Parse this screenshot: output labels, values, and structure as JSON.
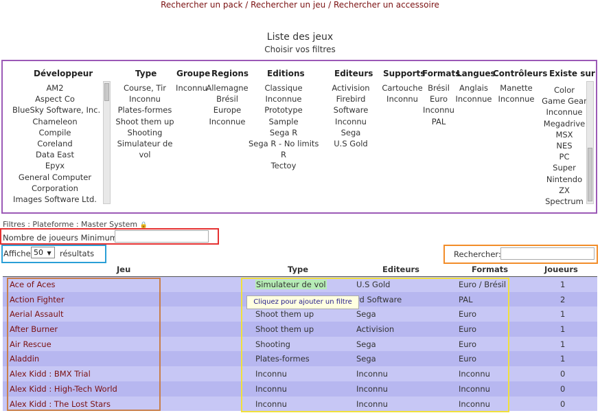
{
  "nav": {
    "link_pack": "Rechercher un pack",
    "sep1": "/",
    "link_jeu": "Rechercher un jeu",
    "sep2": "/",
    "link_accessoire": "Rechercher un accessoire"
  },
  "page": {
    "title": "Liste des jeux",
    "subtitle": "Choisir vos filtres"
  },
  "filters": {
    "developpeur": {
      "label": "Développeur",
      "items": [
        "AM2",
        "Aspect Co",
        "BlueSky Software, Inc.",
        "Chameleon",
        "Compile",
        "Coreland",
        "Data East",
        "Epyx",
        "General Computer",
        "Corporation",
        "Images Software Ltd."
      ]
    },
    "type": {
      "label": "Type",
      "items": [
        "Course, Tir",
        "Inconnu",
        "Plates-formes",
        "Shoot them up",
        "Shooting",
        "Simulateur de",
        "vol"
      ]
    },
    "groupe": {
      "label": "Groupe",
      "items": [
        "Inconnu"
      ]
    },
    "regions": {
      "label": "Regions",
      "items": [
        "Allemagne",
        "Brésil",
        "Europe",
        "Inconnue"
      ]
    },
    "editions": {
      "label": "Editions",
      "items": [
        "Classique",
        "Inconnue",
        "Prototype",
        "Sample",
        "Sega R",
        "Sega R - No limits",
        "R",
        "Tectoy"
      ]
    },
    "editeurs": {
      "label": "Editeurs",
      "items": [
        "Activision",
        "Firebird",
        "Software",
        "Inconnu",
        "Sega",
        "U.S Gold"
      ]
    },
    "supports": {
      "label": "Supports",
      "items": [
        "Cartouche",
        "Inconnu"
      ]
    },
    "formats": {
      "label": "Formats",
      "items": [
        "Brésil",
        "Euro",
        "Inconnu",
        "PAL"
      ]
    },
    "langues": {
      "label": "Langues",
      "items": [
        "Anglais",
        "Inconnue"
      ]
    },
    "controleurs": {
      "label": "Contrôleurs",
      "items": [
        "Manette",
        "Inconnue"
      ]
    },
    "existe_sur": {
      "label": "Existe sur",
      "items": [
        "Color",
        "Game Gear",
        "Inconnue",
        "Megadrive",
        "MSX",
        "NES",
        "PC",
        "Super",
        "Nintendo",
        "ZX",
        "Spectrum"
      ]
    }
  },
  "active_filters": {
    "text": "Filtres : Plateforme : Master System",
    "lock_icon": "🔒"
  },
  "min_players": {
    "label": "Nombre de joueurs Minimum :",
    "value": ""
  },
  "page_size": {
    "label": "Affiche",
    "value": "50",
    "arrow": "▼",
    "suffix": "résultats"
  },
  "search": {
    "label": "Rechercher:",
    "value": ""
  },
  "table": {
    "headers": {
      "jeu": "Jeu",
      "type": "Type",
      "editeurs": "Editeurs",
      "formats": "Formats",
      "joueurs": "Joueurs"
    },
    "rows": [
      {
        "jeu": "Ace of Aces",
        "type": "Simulateur de vol",
        "editeurs": "U.S Gold",
        "formats": "Euro / Brésil",
        "joueurs": "1"
      },
      {
        "jeu": "Action Fighter",
        "type": "",
        "editeurs": "rd Software",
        "formats": "PAL",
        "joueurs": "2"
      },
      {
        "jeu": "Aerial Assault",
        "type": "Shoot them up",
        "editeurs": "Sega",
        "formats": "Euro",
        "joueurs": "1"
      },
      {
        "jeu": "After Burner",
        "type": "Shoot them up",
        "editeurs": "Activision",
        "formats": "Euro",
        "joueurs": "1"
      },
      {
        "jeu": "Air Rescue",
        "type": "Shooting",
        "editeurs": "Sega",
        "formats": "Euro",
        "joueurs": "1"
      },
      {
        "jeu": "Aladdin",
        "type": "Plates-formes",
        "editeurs": "Sega",
        "formats": "Euro",
        "joueurs": "1"
      },
      {
        "jeu": "Alex Kidd : BMX Trial",
        "type": "Inconnu",
        "editeurs": "Inconnu",
        "formats": "Inconnu",
        "joueurs": "0"
      },
      {
        "jeu": "Alex Kidd : High-Tech World",
        "type": "Inconnu",
        "editeurs": "Inconnu",
        "formats": "Inconnu",
        "joueurs": "0"
      },
      {
        "jeu": "Alex Kidd : The Lost Stars",
        "type": "Inconnu",
        "editeurs": "Inconnu",
        "formats": "Inconnu",
        "joueurs": "0"
      }
    ]
  },
  "tooltip": {
    "text": "Cliquez pour ajouter un filtre"
  }
}
